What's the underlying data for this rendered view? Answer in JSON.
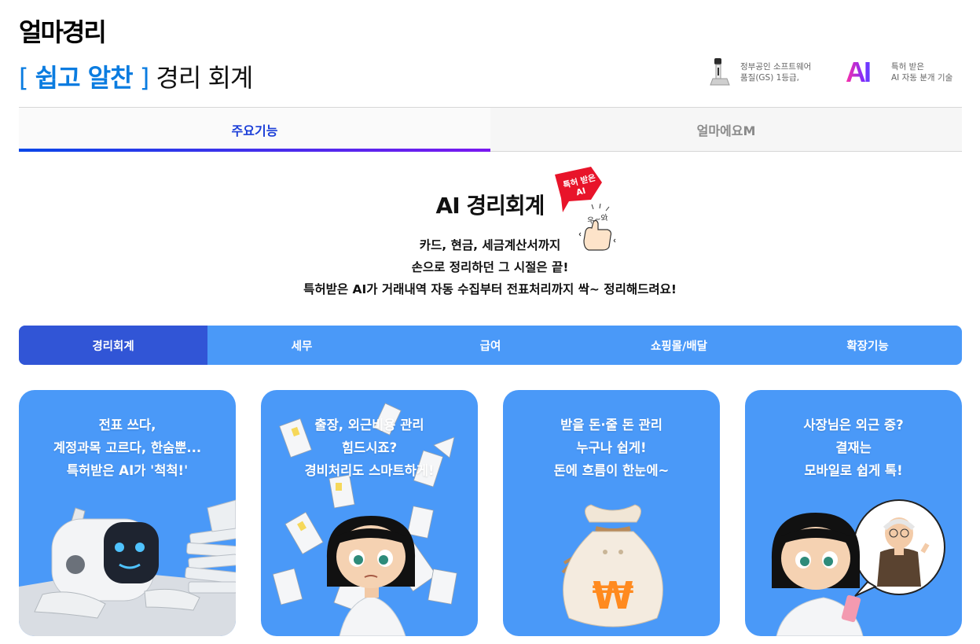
{
  "brand": {
    "logo": "얼마경리",
    "slogan_open": "[",
    "slogan_em": "쉽고 알찬",
    "slogan_close": "]",
    "slogan_rest": "경리 회계"
  },
  "badges": [
    {
      "icon": "gs-certification-icon",
      "line1": "정부공인 소프트웨어",
      "line2": "품질(GS) 1등급,"
    },
    {
      "icon": "ai-logo-icon",
      "logo_text": "AI",
      "line1": "특허 받은",
      "line2": "AI 자동 분개 기술"
    }
  ],
  "tabs": [
    {
      "label": "주요기능",
      "active": true
    },
    {
      "label": "얼마에요M",
      "active": false
    }
  ],
  "hero": {
    "title": "AI 경리회계",
    "tag_line1": "특허 받은",
    "tag_line2": "AI",
    "wow_text": "우~와",
    "lines": [
      "카드, 현금, 세금계산서까지",
      "손으로 정리하던 그 시절은 끝!",
      "특허받은 AI가 거래내역 자동 수집부터 전표처리까지 싹~ 정리해드려요!"
    ]
  },
  "categories": [
    {
      "label": "경리회계",
      "active": true
    },
    {
      "label": "세무",
      "active": false
    },
    {
      "label": "급여",
      "active": false
    },
    {
      "label": "쇼핑몰/배달",
      "active": false
    },
    {
      "label": "확장기능",
      "active": false
    }
  ],
  "cards": [
    {
      "lines": [
        "전표 쓰다,",
        "계정과목 고르다, 한숨뿐...",
        "특허받은 AI가 '척척!'"
      ],
      "image": "robot-illustration"
    },
    {
      "lines": [
        "출장, 외근비용 관리",
        "힘드시죠?",
        "경비처리도 스마트하게!"
      ],
      "image": "receipts-girl-illustration"
    },
    {
      "lines": [
        "받을 돈·줄 돈 관리",
        "누구나 쉽게!",
        "돈에 흐름이 한눈에~"
      ],
      "image": "money-bag-illustration"
    },
    {
      "lines": [
        "사장님은 외근 중?",
        "결재는",
        "모바일로 쉽게 톡!"
      ],
      "image": "mobile-approval-illustration"
    }
  ],
  "colors": {
    "accent_blue": "#0a7ce0",
    "tab_active": "#1c3fd8",
    "category_bar": "#4a99f8",
    "category_active": "#3155d6",
    "card_bg": "#4a99f8",
    "tag_red": "#e8142a"
  }
}
